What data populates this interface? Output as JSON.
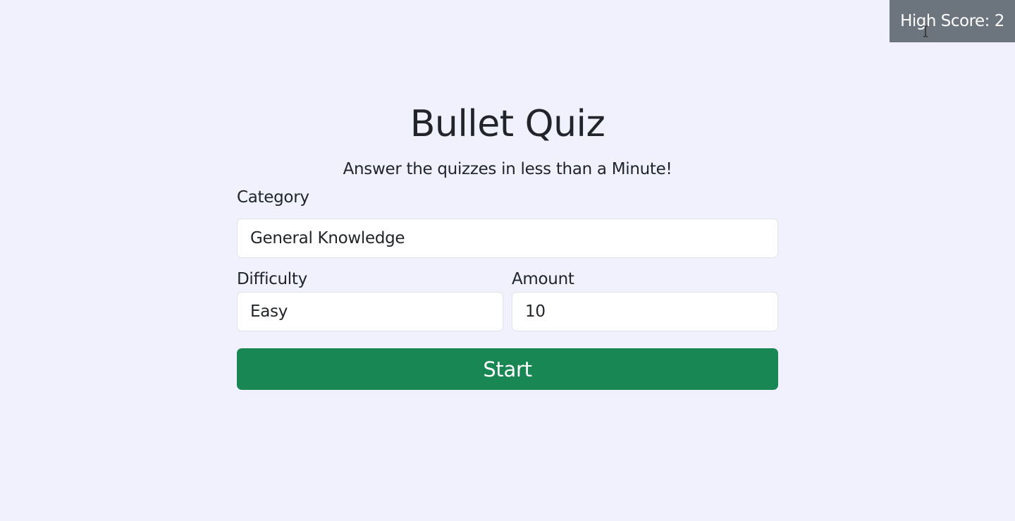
{
  "high_score": {
    "text": "High Score: 2"
  },
  "header": {
    "title": "Bullet Quiz",
    "subtitle": "Answer the quizzes in less than a Minute!"
  },
  "form": {
    "category": {
      "label": "Category",
      "value": "General Knowledge"
    },
    "difficulty": {
      "label": "Difficulty",
      "value": "Easy"
    },
    "amount": {
      "label": "Amount",
      "value": "10"
    },
    "start_label": "Start"
  },
  "colors": {
    "background": "#f0f1fd",
    "high_score_bg": "#6c757d",
    "start_button_bg": "#198754",
    "text": "#212529"
  },
  "icons": {
    "cursor": "text-cursor-icon"
  }
}
